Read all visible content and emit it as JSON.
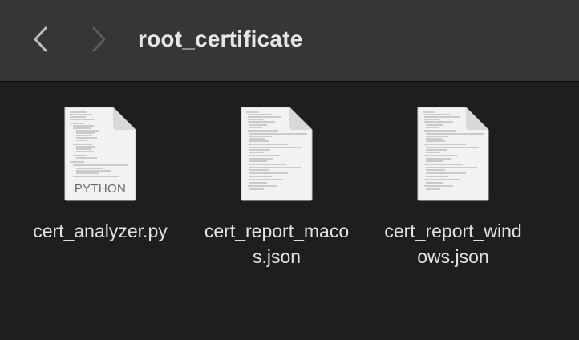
{
  "window": {
    "title": "root_certificate"
  },
  "toolbar": {
    "back_icon": "chevron-left-icon",
    "forward_icon": "chevron-right-icon",
    "back_enabled": true,
    "forward_enabled": false
  },
  "files": [
    {
      "name_line1": "cert_analyzer.py",
      "name_line2": "",
      "type_label": "PYTHON",
      "icon": "python-file-icon"
    },
    {
      "name_line1": "cert_report_maco",
      "name_line2": "s.json",
      "type_label": "",
      "icon": "json-file-icon"
    },
    {
      "name_line1": "cert_report_wind",
      "name_line2": "ows.json",
      "type_label": "",
      "icon": "json-file-icon"
    }
  ],
  "colors": {
    "toolbar_bg": "#363636",
    "content_bg": "#1e1e1e",
    "title_text": "#e6e6e6",
    "file_text": "#e2e2e2"
  }
}
